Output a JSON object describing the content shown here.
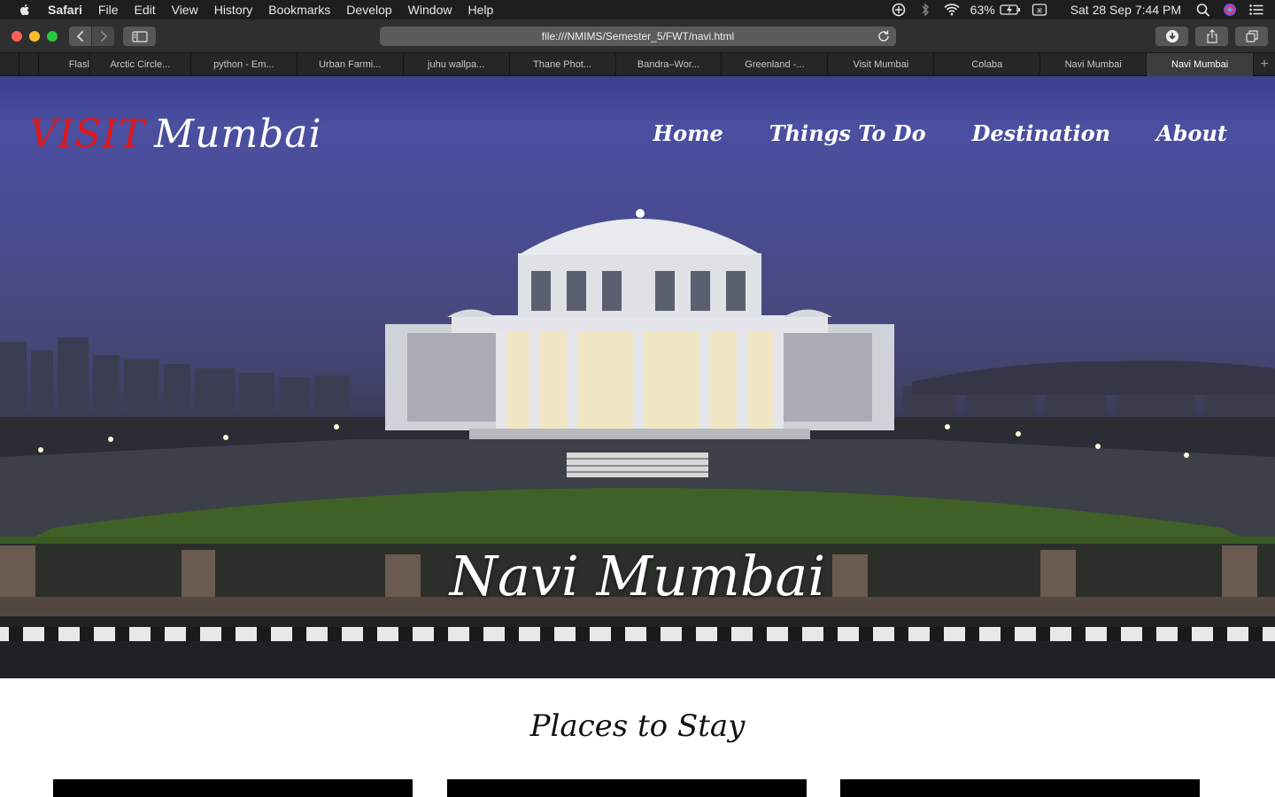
{
  "menubar": {
    "app": "Safari",
    "items": [
      "File",
      "Edit",
      "View",
      "History",
      "Bookmarks",
      "Develop",
      "Window",
      "Help"
    ],
    "battery": "63%",
    "datetime": "Sat 28 Sep  7:44 PM"
  },
  "toolbar": {
    "url": "file:///NMIMS/Semester_5/FWT/navi.html"
  },
  "tabs": [
    "Flasl",
    "Arctic Circle...",
    "python - Em...",
    "Urban Farmi...",
    "juhu wallpa...",
    "Thane Phot...",
    "Bandra–Wor...",
    "Greenland -...",
    "Visit Mumbai",
    "Colaba",
    "Navi Mumbai",
    "Navi Mumbai"
  ],
  "site": {
    "logo_part1": "VISIT",
    "logo_part2": "Mumbai",
    "nav": [
      "Home",
      "Things To Do",
      "Destination",
      "About"
    ],
    "hero_title": "Navi Mumbai",
    "section_title": "Places to Stay"
  }
}
